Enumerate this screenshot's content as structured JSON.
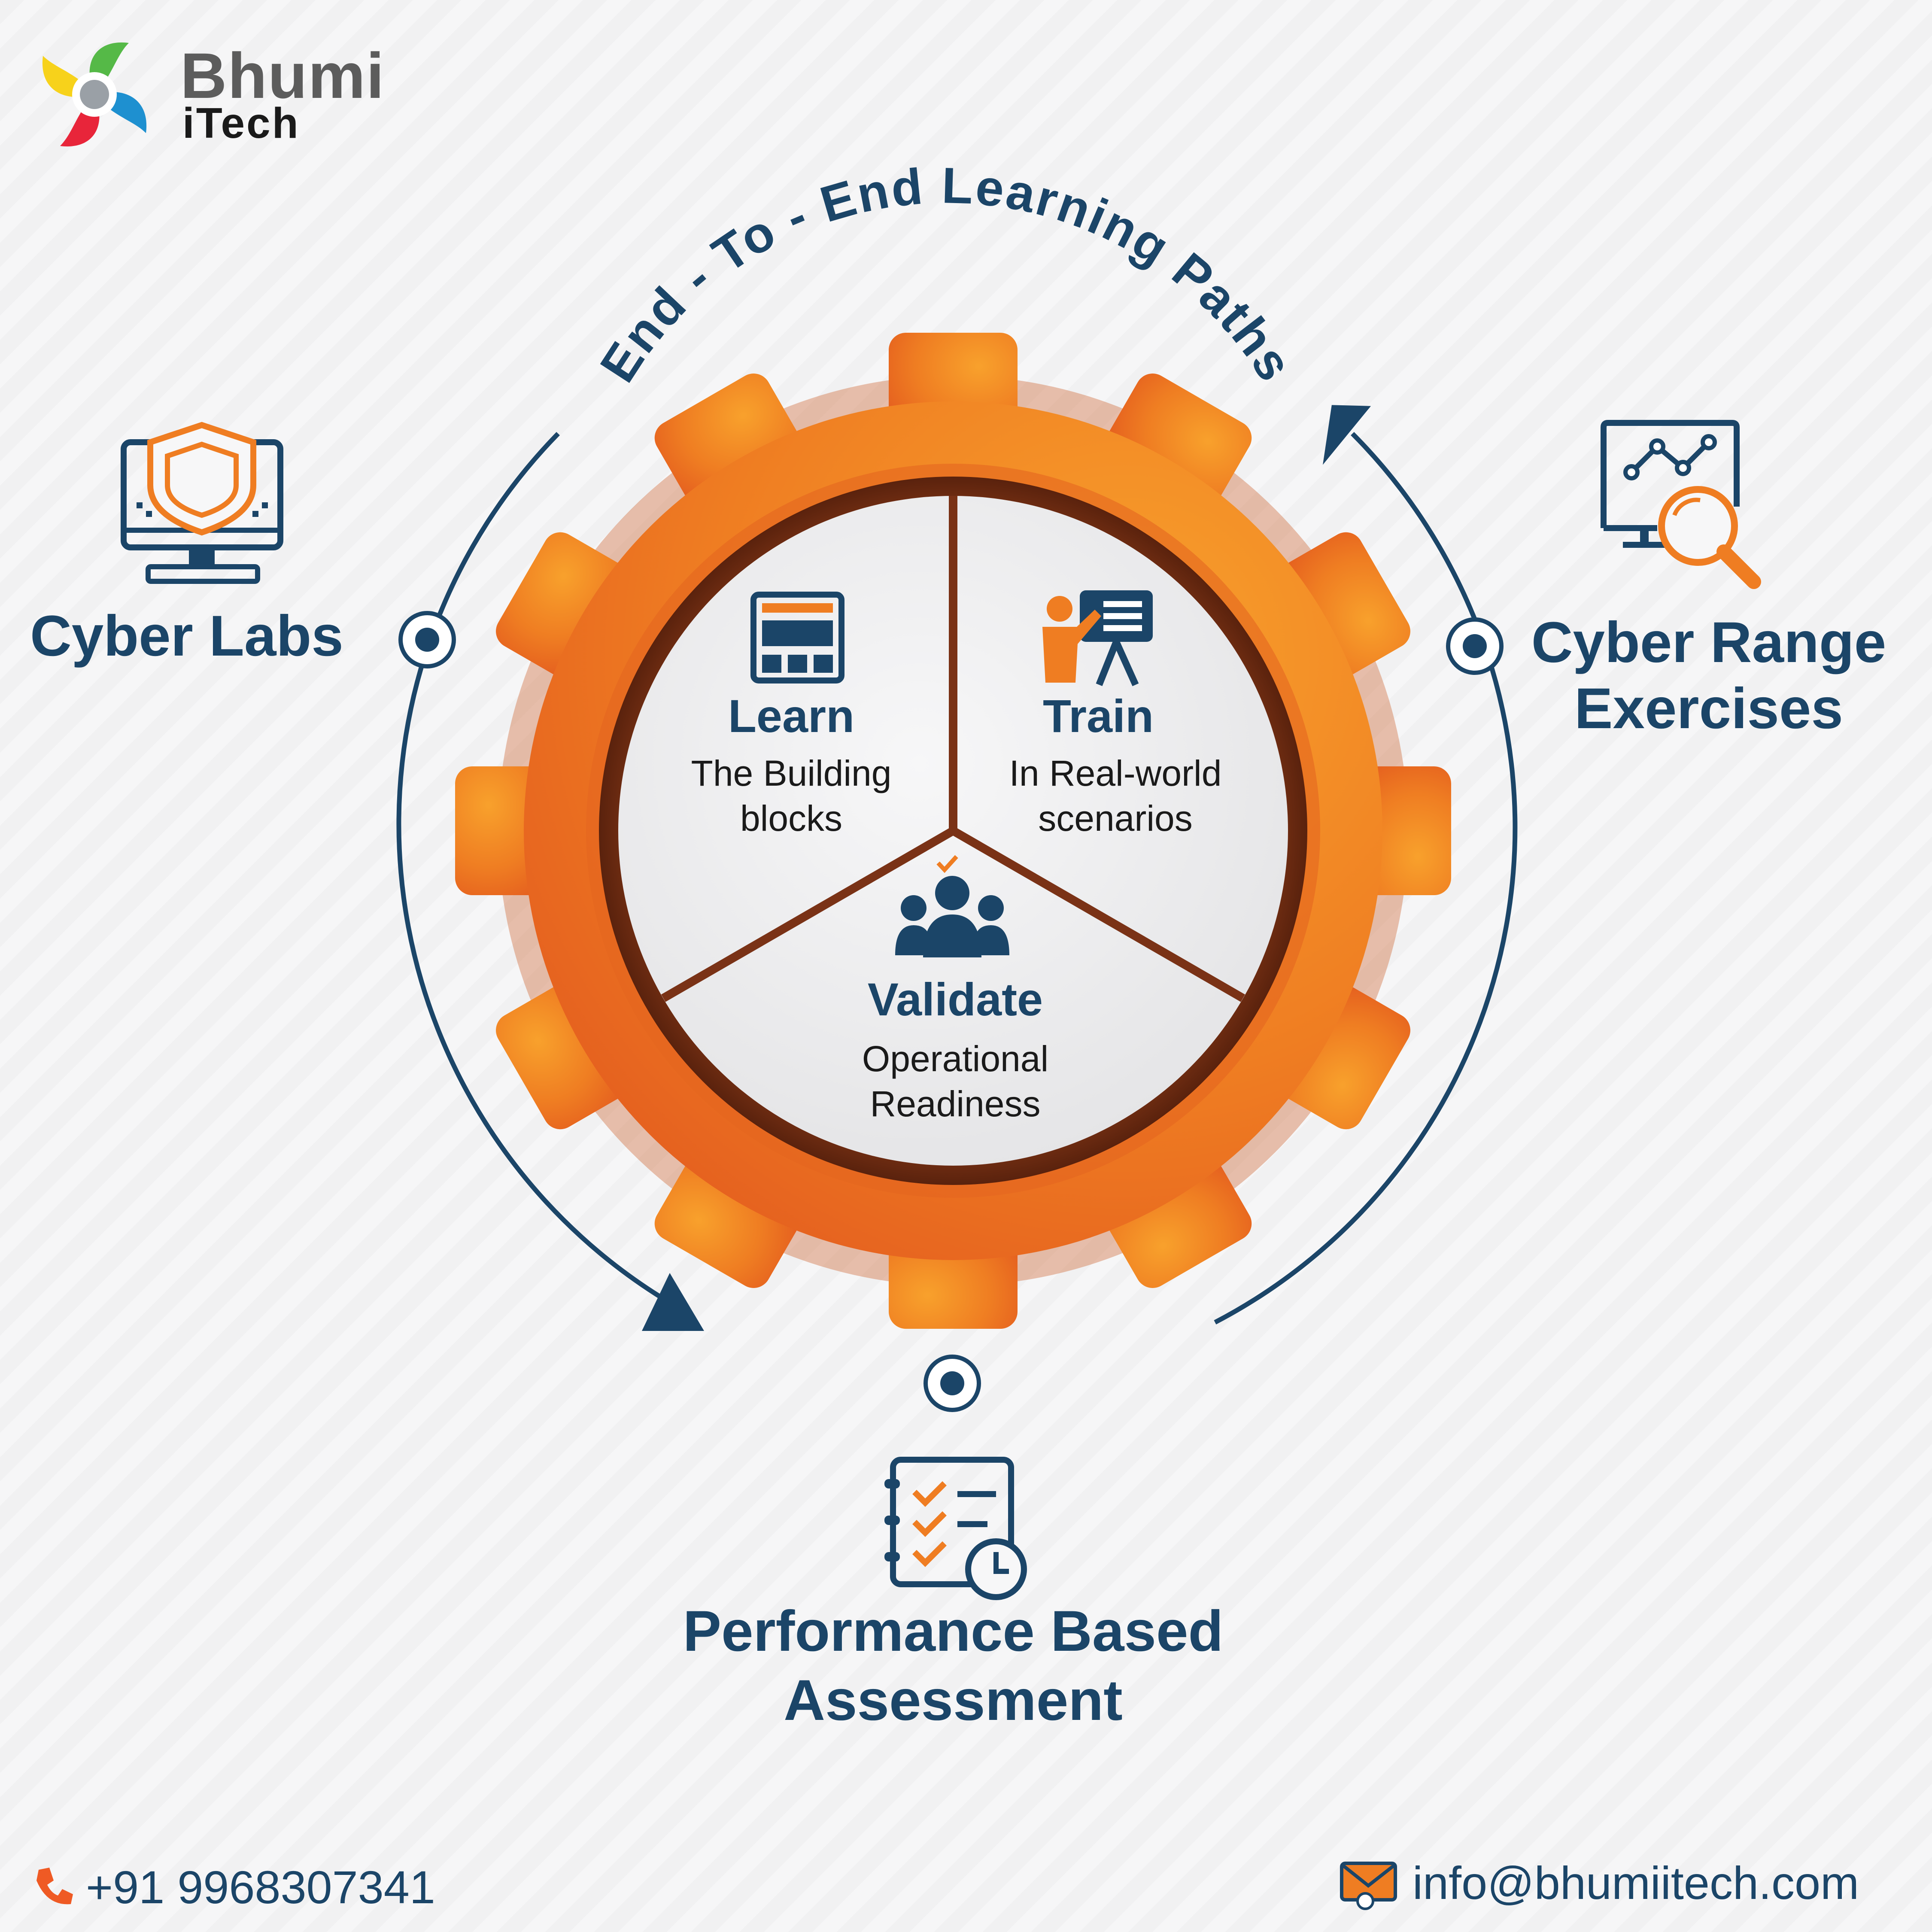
{
  "brand": {
    "name": "Bhumi",
    "sub": "iTech",
    "colors": {
      "green": "#55b947",
      "blue": "#1e90d0",
      "red": "#e8253a",
      "yellow": "#f7d21b",
      "gray": "#5c5c5c"
    }
  },
  "diagram": {
    "arc_title": "End - To - End Learning Paths",
    "segments": [
      {
        "title": "Learn",
        "line1": "The Building",
        "line2": "blocks",
        "icon": "browser-window-icon"
      },
      {
        "title": "Train",
        "line1": "In Real-world",
        "line2": "scenarios",
        "icon": "trainer-presentation-icon"
      },
      {
        "title": "Validate",
        "line1": "Operational",
        "line2": "Readiness",
        "icon": "team-check-icon"
      }
    ],
    "nodes": {
      "cyber_labs": {
        "label": "Cyber Labs",
        "icon": "monitor-shield-icon"
      },
      "cyber_range": {
        "line1": "Cyber Range",
        "line2": "Exercises",
        "icon": "analytics-search-icon"
      },
      "assessment": {
        "line1": "Performance Based",
        "line2": "Assessment",
        "icon": "checklist-clock-icon"
      }
    },
    "colors": {
      "navy": "#1b4568",
      "orange": "#ef7d22",
      "orange_dark": "#e2571e",
      "brown": "#7a3216",
      "disc": "#ededee"
    }
  },
  "contact": {
    "phone": "+91 9968307341",
    "email": "info@bhumiitech.com",
    "phone_icon": "phone-icon",
    "email_icon": "mail-icon"
  }
}
